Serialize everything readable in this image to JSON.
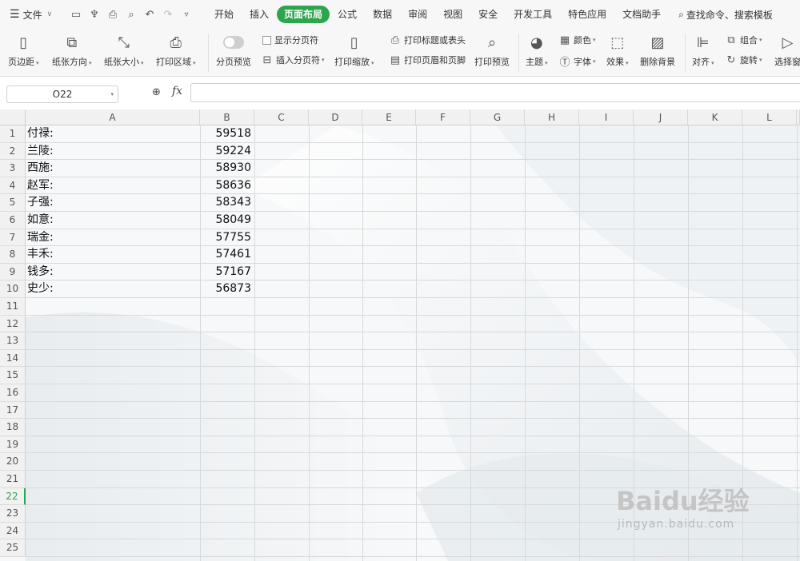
{
  "menubar": {
    "file_label": "文件",
    "tabs": [
      {
        "label": "开始",
        "active": false
      },
      {
        "label": "插入",
        "active": false
      },
      {
        "label": "页面布局",
        "active": true
      },
      {
        "label": "公式",
        "active": false
      },
      {
        "label": "数据",
        "active": false
      },
      {
        "label": "审阅",
        "active": false
      },
      {
        "label": "视图",
        "active": false
      },
      {
        "label": "安全",
        "active": false
      },
      {
        "label": "开发工具",
        "active": false
      },
      {
        "label": "特色应用",
        "active": false
      },
      {
        "label": "文档助手",
        "active": false
      }
    ],
    "search_text": "查找命令、搜索模板",
    "accent_color": "#2da44e"
  },
  "ribbon": {
    "margins": "页边距",
    "orientation": "纸张方向",
    "size": "纸张大小",
    "print_area": "打印区域",
    "page_break_preview": "分页预览",
    "show_page_breaks": "显示分页符",
    "insert_page_break": "插入分页符",
    "print_scaling": "打印缩放",
    "print_titles": "打印标题或表头",
    "header_footer": "打印页眉和页脚",
    "print_preview": "打印预览",
    "theme": "主题",
    "colors": "颜色",
    "fonts": "字体",
    "effects": "效果",
    "delete_background": "删除背景",
    "align": "对齐",
    "group": "组合",
    "rotate": "旋转",
    "selection_pane": "选择窗"
  },
  "formula_bar": {
    "name_box": "O22",
    "fx_label": "fx",
    "formula": ""
  },
  "grid": {
    "columns": [
      "A",
      "B",
      "C",
      "D",
      "E",
      "F",
      "G",
      "H",
      "I",
      "J",
      "K",
      "L"
    ],
    "rows": [
      "1",
      "2",
      "3",
      "4",
      "5",
      "6",
      "7",
      "8",
      "9",
      "10",
      "11",
      "12",
      "13",
      "14",
      "15",
      "16",
      "17",
      "18",
      "19",
      "20",
      "21",
      "22",
      "23",
      "24",
      "25"
    ],
    "selected_row": "22",
    "data": [
      {
        "name": "付禄:",
        "value": "59518"
      },
      {
        "name": "兰陵:",
        "value": "59224"
      },
      {
        "name": "西施:",
        "value": "58930"
      },
      {
        "name": "赵军:",
        "value": "58636"
      },
      {
        "name": "子强:",
        "value": "58343"
      },
      {
        "name": "如意:",
        "value": "58049"
      },
      {
        "name": "瑞金:",
        "value": "57755"
      },
      {
        "name": "丰禾:",
        "value": "57461"
      },
      {
        "name": "钱多:",
        "value": "57167"
      },
      {
        "name": "史少:",
        "value": "56873"
      }
    ]
  },
  "watermark": {
    "logo": "Baidu经验",
    "url": "jingyan.baidu.com"
  }
}
